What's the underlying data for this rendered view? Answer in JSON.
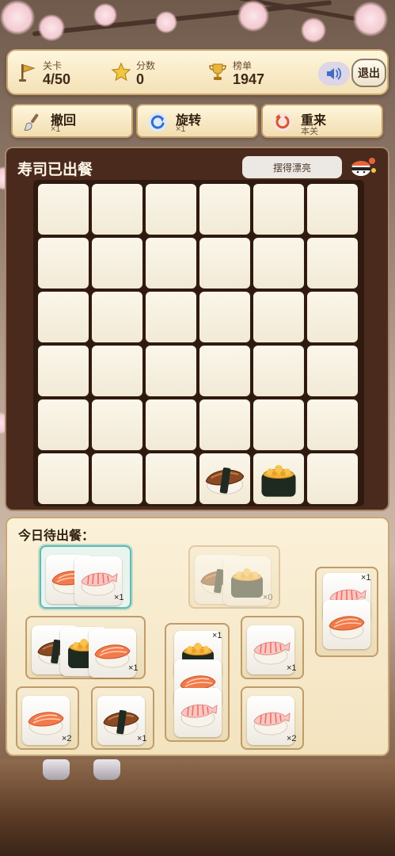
{
  "stats": {
    "level": {
      "label": "关卡",
      "value": "4/50"
    },
    "score": {
      "label": "分数",
      "value": "0"
    },
    "rank": {
      "label": "榜单",
      "value": "1947"
    }
  },
  "exit_label": "退出",
  "tools": {
    "undo": {
      "label": "撤回",
      "sub": "×1"
    },
    "rotate": {
      "label": "旋转",
      "sub": "×1"
    },
    "restart": {
      "label": "重来",
      "sub": "本关"
    }
  },
  "board": {
    "title": "寿司已出餐",
    "badge": "摆得漂亮",
    "rows": 6,
    "cols": 6,
    "placed": [
      {
        "row": 5,
        "col": 3,
        "sushi": "unagi"
      },
      {
        "row": 5,
        "col": 4,
        "sushi": "uni"
      }
    ]
  },
  "queue": {
    "title": "今日待出餐：",
    "boxes": [
      {
        "tiles": [
          "salmon",
          "shrimp"
        ],
        "count": "×1",
        "state": "selected"
      },
      {
        "tiles": [
          "unagi",
          "uni"
        ],
        "count": "×0",
        "state": "empty"
      },
      {
        "tiles": [
          "shrimp",
          "salmon"
        ],
        "count": "×1",
        "state": "normal"
      },
      {
        "tiles": [
          "unagi",
          "uni",
          "salmon"
        ],
        "count": "×1",
        "state": "normal"
      },
      {
        "tiles": [
          "uni",
          "salmon",
          "shrimp"
        ],
        "count": "×1",
        "state": "normal"
      },
      {
        "tiles": [
          "shrimp"
        ],
        "count": "×1",
        "state": "normal"
      },
      {
        "tiles": [
          "salmon"
        ],
        "count": "×2",
        "state": "normal"
      },
      {
        "tiles": [
          "unagi"
        ],
        "count": "×1",
        "state": "normal"
      },
      {
        "tiles": [
          "shrimp"
        ],
        "count": "×2",
        "state": "normal"
      }
    ]
  },
  "icons": {
    "level": "flag-icon",
    "score": "star-icon",
    "rank": "trophy-icon",
    "sound": "speaker-icon",
    "undo": "brush-icon",
    "rotate": "rotate-icon",
    "restart": "restart-icon"
  },
  "colors": {
    "accent": "#5fb9b5",
    "panel": "#4a2a1c",
    "cream": "#fbf1d9"
  }
}
